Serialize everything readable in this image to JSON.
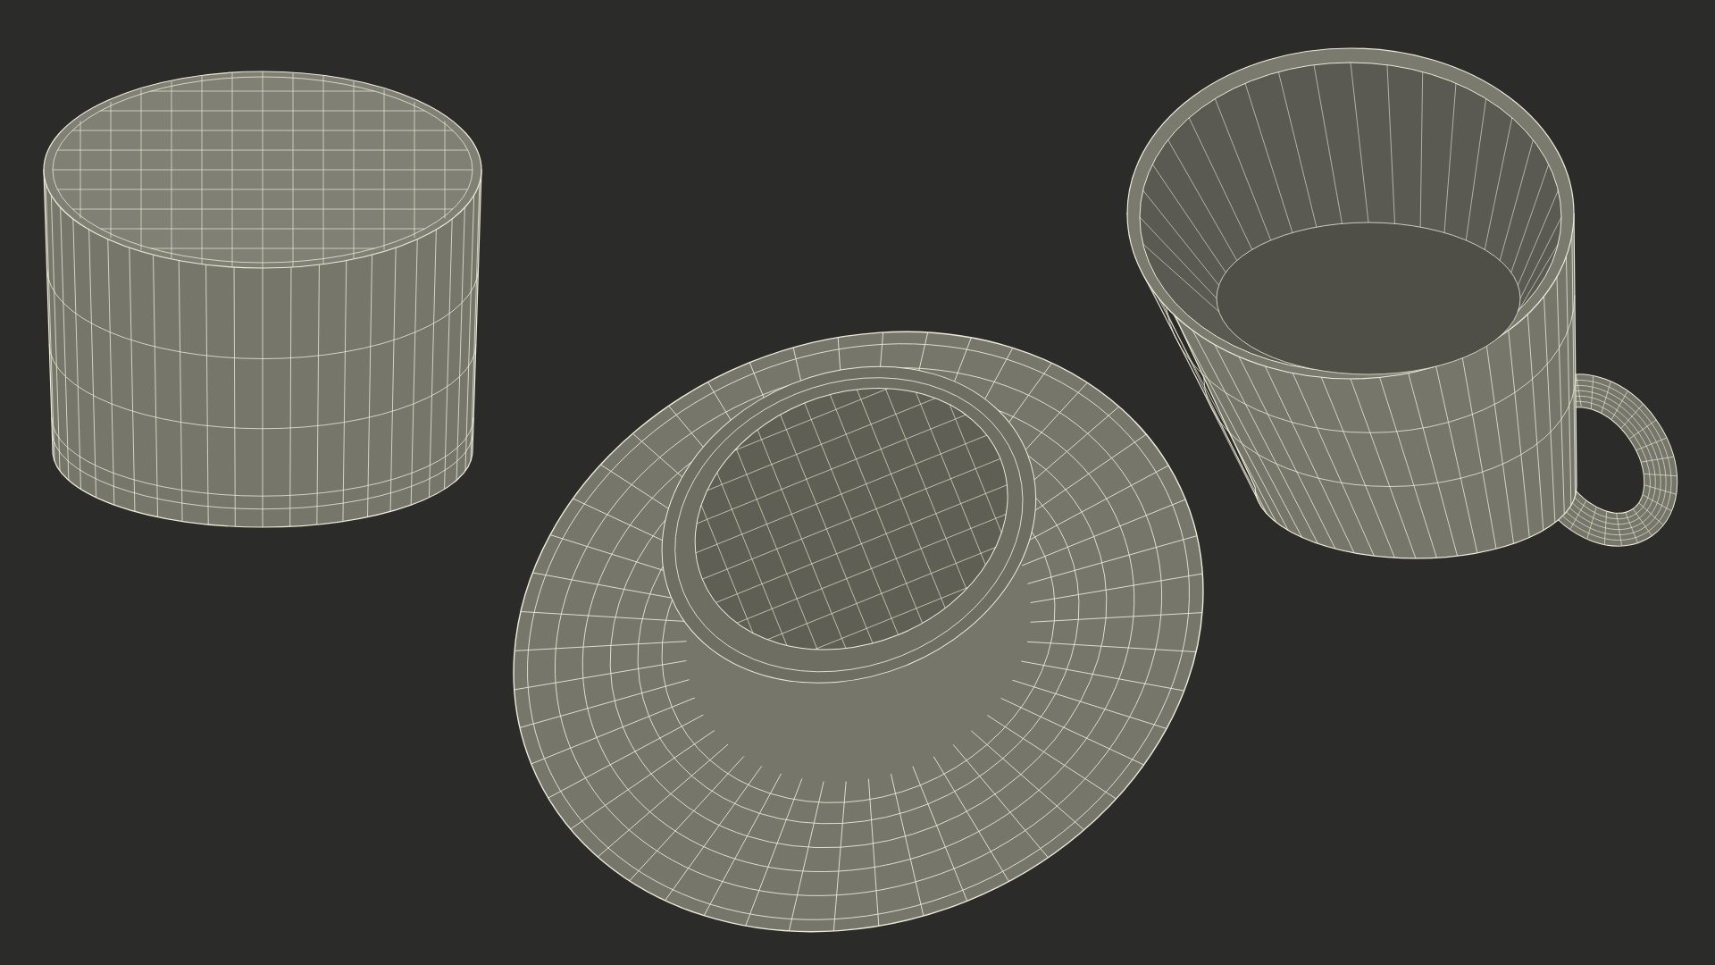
{
  "scene": {
    "objects": [
      {
        "kind": "upturned-cup"
      },
      {
        "kind": "saucer"
      },
      {
        "kind": "cup"
      }
    ]
  }
}
